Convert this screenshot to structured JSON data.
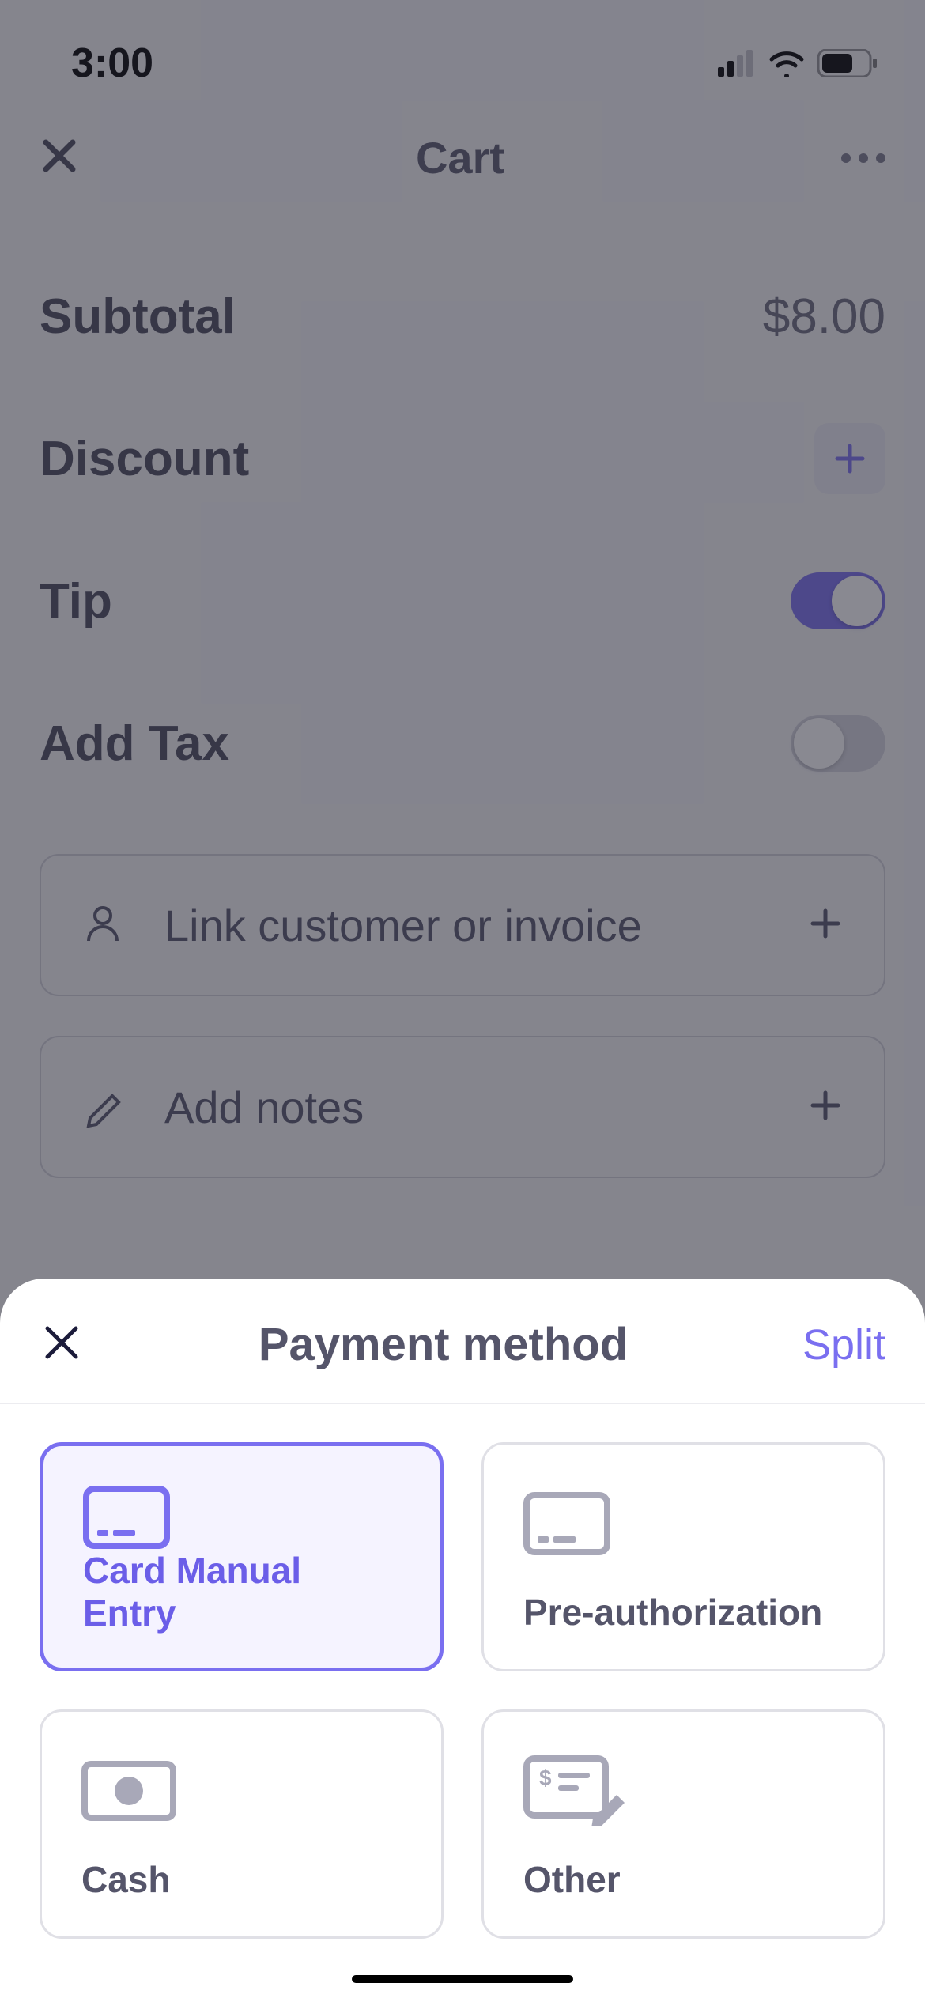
{
  "status": {
    "time": "3:00"
  },
  "header": {
    "title": "Cart"
  },
  "rows": {
    "subtotal_label": "Subtotal",
    "subtotal_value": "$8.00",
    "discount_label": "Discount",
    "tip_label": "Tip",
    "addtax_label": "Add Tax"
  },
  "actions": {
    "link_customer": "Link customer or invoice",
    "add_notes": "Add notes"
  },
  "sheet": {
    "title": "Payment method",
    "split": "Split",
    "options": {
      "card_manual": "Card Manual Entry",
      "preauth": "Pre-authorization",
      "cash": "Cash",
      "other": "Other"
    }
  }
}
